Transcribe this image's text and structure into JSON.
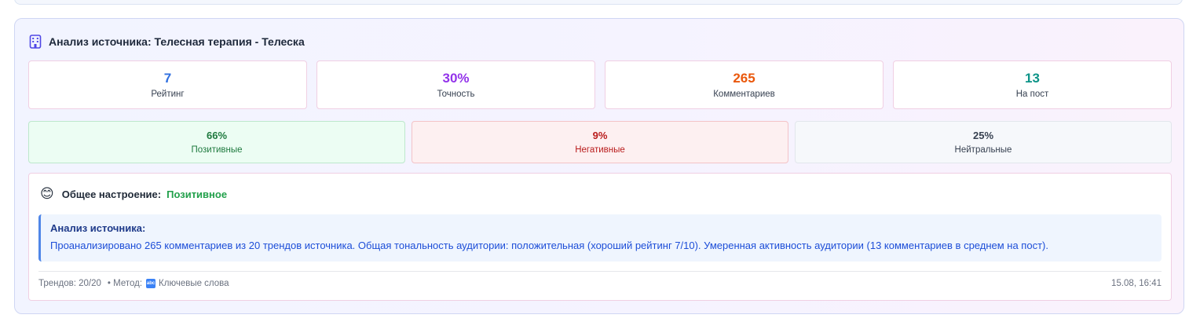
{
  "header": {
    "title": "Анализ источника: Телесная терапия - Телеска",
    "icon": "building-icon"
  },
  "stats": [
    {
      "value": "7",
      "label": "Рейтинг",
      "color": "#2f6fe0"
    },
    {
      "value": "30%",
      "label": "Точность",
      "color": "#9333ea"
    },
    {
      "value": "265",
      "label": "Комментариев",
      "color": "#ea580c"
    },
    {
      "value": "13",
      "label": "На пост",
      "color": "#0d9488"
    }
  ],
  "sentiment": {
    "positive": {
      "value": "66%",
      "label": "Позитивные"
    },
    "negative": {
      "value": "9%",
      "label": "Негативные"
    },
    "neutral": {
      "value": "25%",
      "label": "Нейтральные"
    }
  },
  "mood": {
    "emoji": "😊",
    "label": "Общее настроение:",
    "value": "Позитивное"
  },
  "analysis": {
    "heading": "Анализ источника:",
    "text": "Проанализировано 265 комментариев из 20 трендов источника. Общая тональность аудитории: положительная (хороший рейтинг 7/10). Умеренная активность аудитории (13 комментариев в среднем на пост)."
  },
  "footer": {
    "trends": "Трендов: 20/20",
    "method_prefix": "• Метод:",
    "method_icon": "abc-icon",
    "method": "Ключевые слова",
    "timestamp": "15.08, 16:41"
  }
}
